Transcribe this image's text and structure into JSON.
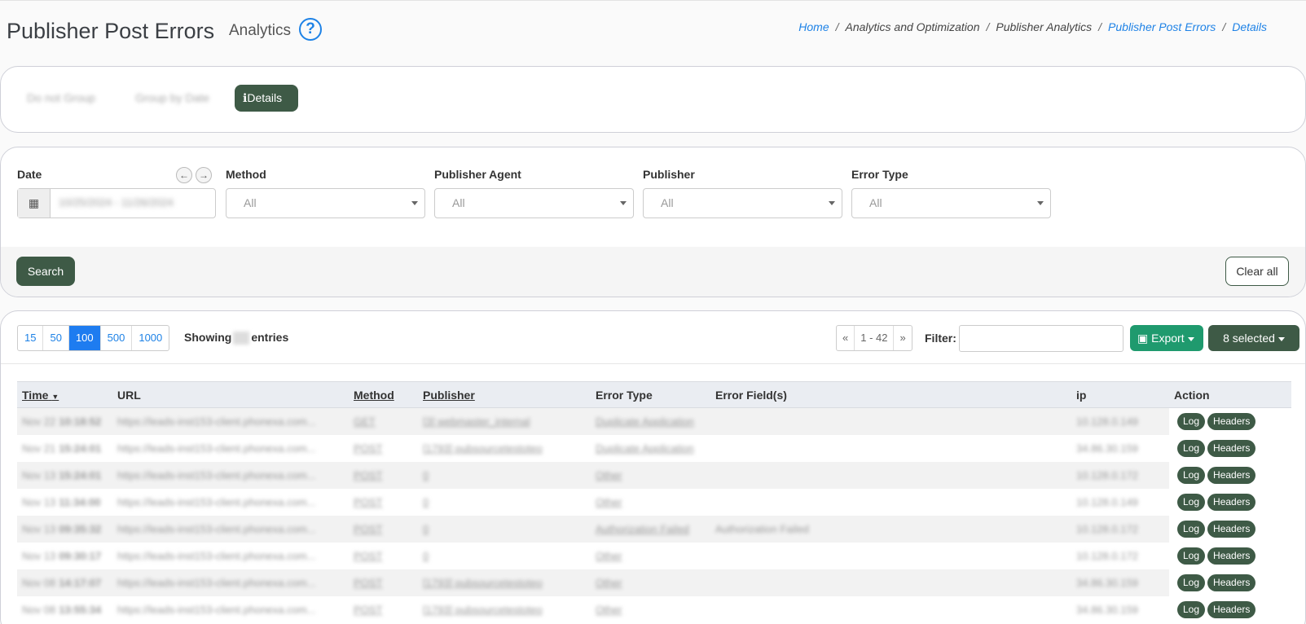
{
  "header": {
    "title": "Publisher Post Errors",
    "subtitle": "Analytics",
    "help_icon_glyph": "?",
    "breadcrumb": [
      {
        "label": "Home",
        "link": true
      },
      {
        "label": "Analytics and Optimization",
        "link": false
      },
      {
        "label": "Publisher Analytics",
        "link": false
      },
      {
        "label": "Publisher Post Errors",
        "link": true
      },
      {
        "label": "Details",
        "link": true
      }
    ]
  },
  "view_modes": {
    "do_not_group": "Do not Group",
    "group_by_date": "Group by Date",
    "details": "Details",
    "details_icon": "info-icon"
  },
  "filters": {
    "date_label": "Date",
    "date_value": "10/25/2024 - 11/26/2024",
    "method_label": "Method",
    "method_value": "All",
    "publisher_agent_label": "Publisher Agent",
    "publisher_agent_value": "All",
    "publisher_label": "Publisher",
    "publisher_value": "All",
    "error_type_label": "Error Type",
    "error_type_value": "All",
    "search_label": "Search",
    "clear_label": "Clear all"
  },
  "table_controls": {
    "page_sizes": [
      "15",
      "50",
      "100",
      "500",
      "1000"
    ],
    "active_page_size": "100",
    "showing_prefix": "Showing",
    "showing_suffix": "entries",
    "pager_prev": "«",
    "pager_range": "1 - 42",
    "pager_next": "»",
    "filter_label": "Filter:",
    "export_label": "Export",
    "selected_label": "8 selected"
  },
  "table": {
    "columns": [
      "Time",
      "URL",
      "Method",
      "Publisher",
      "Error Type",
      "Error Field(s)",
      "ip",
      "Action"
    ],
    "action_log": "Log",
    "action_headers": "Headers",
    "rows": [
      {
        "date": "Nov 22",
        "time": "10:18:52",
        "url": "https://leads-inst153-client.phonexa.com...",
        "method": "GET",
        "publisher": "[3] webmaster_internal",
        "error_type": "Duplicate Application",
        "error_fields": "",
        "ip": "10.128.0.149"
      },
      {
        "date": "Nov 21",
        "time": "15:24:01",
        "url": "https://leads-inst153-client.phonexa.com...",
        "method": "POST",
        "publisher": "[1793] pubsourcetestoteo",
        "error_type": "Duplicate Application",
        "error_fields": "",
        "ip": "34.86.30.159"
      },
      {
        "date": "Nov 13",
        "time": "15:24:01",
        "url": "https://leads-inst153-client.phonexa.com...",
        "method": "POST",
        "publisher": "0",
        "error_type": "Other",
        "error_fields": "",
        "ip": "10.128.0.172"
      },
      {
        "date": "Nov 13",
        "time": "11:34:00",
        "url": "https://leads-inst153-client.phonexa.com...",
        "method": "POST",
        "publisher": "0",
        "error_type": "Other",
        "error_fields": "",
        "ip": "10.128.0.149"
      },
      {
        "date": "Nov 13",
        "time": "09:35:32",
        "url": "https://leads-inst153-client.phonexa.com...",
        "method": "POST",
        "publisher": "0",
        "error_type": "Authorization Failed",
        "error_fields": "Authorization Failed",
        "ip": "10.128.0.172"
      },
      {
        "date": "Nov 13",
        "time": "09:30:17",
        "url": "https://leads-inst153-client.phonexa.com...",
        "method": "POST",
        "publisher": "0",
        "error_type": "Other",
        "error_fields": "",
        "ip": "10.128.0.172"
      },
      {
        "date": "Nov 08",
        "time": "14:17:07",
        "url": "https://leads-inst153-client.phonexa.com...",
        "method": "POST",
        "publisher": "[1793] pubsourcetestoteo",
        "error_type": "Other",
        "error_fields": "",
        "ip": "34.86.30.159"
      },
      {
        "date": "Nov 08",
        "time": "13:55:34",
        "url": "https://leads-inst153-client.phonexa.com...",
        "method": "POST",
        "publisher": "[1793] pubsourcetestoteo",
        "error_type": "Other",
        "error_fields": "",
        "ip": "34.86.30.159"
      }
    ]
  },
  "colors": {
    "accent_green": "#3e5a46",
    "export_green": "#1f9a6e",
    "link_blue": "#1e82e6"
  }
}
